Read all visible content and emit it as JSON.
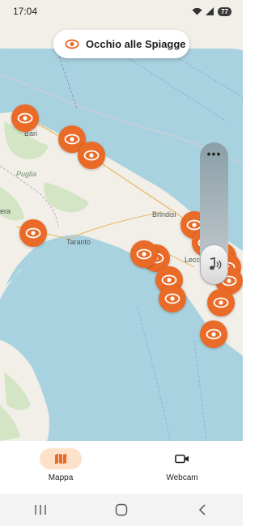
{
  "status_bar": {
    "time": "17:04",
    "battery": "77",
    "icons": [
      "wifi-icon",
      "signal-icon",
      "battery-icon"
    ]
  },
  "app": {
    "title": "Occhio alle Spiagge",
    "accent_color": "#ea6a27",
    "title_icon": "eye-icon"
  },
  "map": {
    "labels": {
      "bari": "Bari",
      "puglia": "Puglia",
      "brindisi": "Brindisi",
      "taranto": "Taranto",
      "lecce": "Lecce",
      "era": "era"
    },
    "marker_icon": "eye-icon",
    "marker_count": 16
  },
  "side_panel": {
    "menu_icon": "more-dots-icon",
    "audio_icon": "music-note-sound-icon"
  },
  "bottom_nav": {
    "items": [
      {
        "label": "Mappa",
        "icon": "map-icon",
        "active": true
      },
      {
        "label": "Webcam",
        "icon": "video-camera-icon",
        "active": false
      }
    ]
  },
  "system_nav": {
    "buttons": [
      "recent-apps-icon",
      "home-icon",
      "back-icon"
    ]
  }
}
